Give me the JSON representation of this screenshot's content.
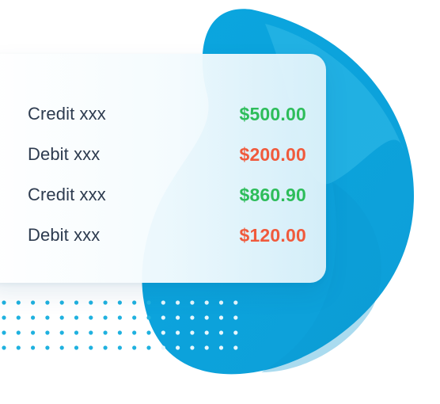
{
  "transactions": [
    {
      "label": "Credit xxx",
      "amount": "$500.00",
      "type": "credit"
    },
    {
      "label": "Debit xxx",
      "amount": "$200.00",
      "type": "debit"
    },
    {
      "label": "Credit xxx",
      "amount": "$860.90",
      "type": "credit"
    },
    {
      "label": "Debit xxx",
      "amount": "$120.00",
      "type": "debit"
    }
  ],
  "colors": {
    "blob": "#12aee2",
    "credit": "#2dbd5a",
    "debit": "#f05a3c",
    "label": "#2d3b4f",
    "dots": "#1fb1df"
  }
}
